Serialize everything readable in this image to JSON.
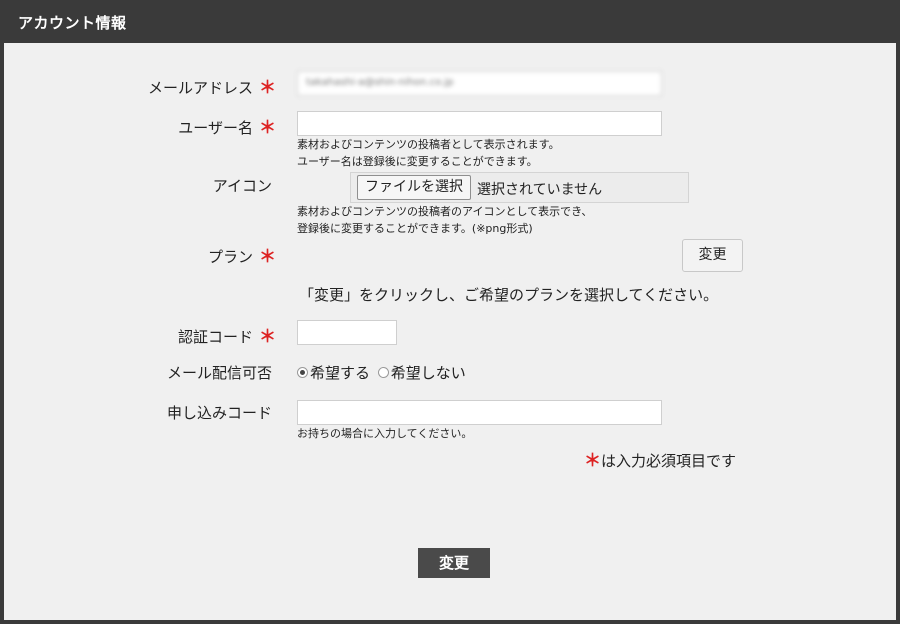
{
  "header": {
    "title": "アカウント情報"
  },
  "required_mark": "＊",
  "fields": {
    "email": {
      "label": "メールアドレス",
      "value": "takahashi-a@shin-nihon.co.jp"
    },
    "username": {
      "label": "ユーザー名",
      "value": "",
      "hint1": "素材およびコンテンツの投稿者として表示されます。",
      "hint2": "ユーザー名は登録後に変更することができます。"
    },
    "icon": {
      "label": "アイコン",
      "file_button": "ファイルを選択",
      "file_status": "選択されていません",
      "hint1": "素材およびコンテンツの投稿者のアイコンとして表示でき、",
      "hint2": "登録後に変更することができます。(※png形式)"
    },
    "plan": {
      "label": "プラン",
      "change_button": "変更",
      "note": "「変更」をクリックし、ご希望のプランを選択してください。"
    },
    "auth_code": {
      "label": "認証コード",
      "value": ""
    },
    "mail_delivery": {
      "label": "メール配信可否",
      "options": [
        "希望する",
        "希望しない"
      ],
      "selected": "希望する"
    },
    "application_code": {
      "label": "申し込みコード",
      "value": "",
      "hint": "お持ちの場合に入力してください。"
    }
  },
  "required_note": "は入力必須項目です",
  "submit_button": "変更",
  "colors": {
    "header_bg": "#3a3a3a",
    "required": "#dd2222",
    "submit_bg": "#4a4a4a",
    "panel_bg": "#f0f0f0"
  }
}
